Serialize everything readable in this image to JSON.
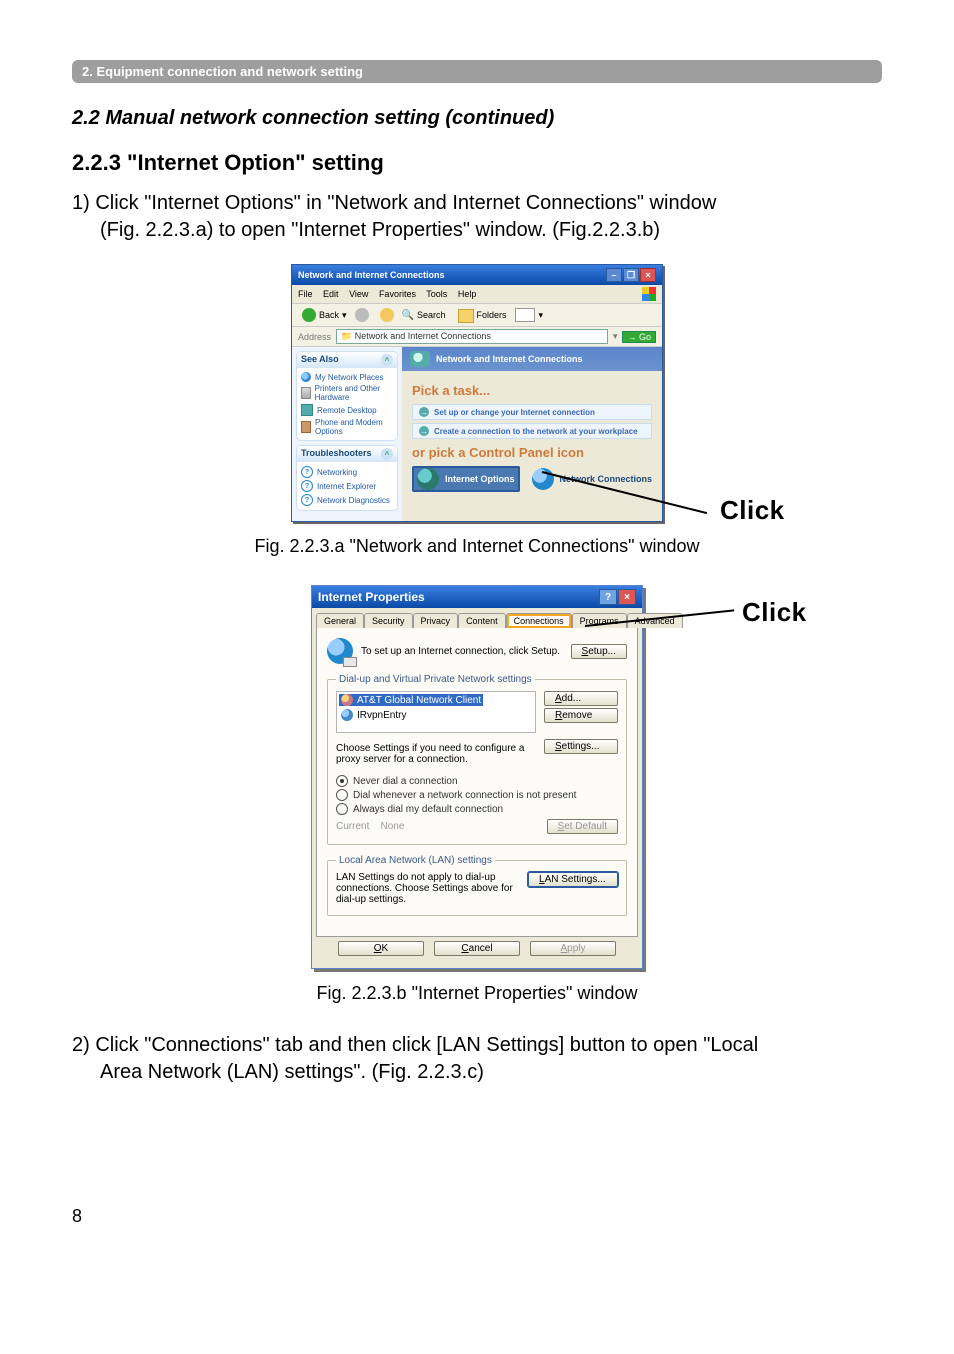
{
  "section_bar": "2. Equipment connection and network setting",
  "h2": "2.2 Manual network connection setting (continued)",
  "h3": "2.2.3 \"Internet Option\" setting",
  "para1_a": "1) Click \"Internet Options\" in \"Network and Internet Connections\" window",
  "para1_b": "(Fig. 2.2.3.a) to open \"Internet Properties\" window. (Fig.2.2.3.b)",
  "fig_a_caption": "Fig. 2.2.3.a \"Network and Internet Connections\" window",
  "fig_b_caption": "Fig. 2.2.3.b \"Internet Properties\" window",
  "para2_a": "2) Click \"Connections\" tab and then click [LAN Settings] button to open \"Local",
  "para2_b": "Area Network (LAN) settings\". (Fig. 2.2.3.c)",
  "page_number": "8",
  "click_label": "Click",
  "figA": {
    "title": "Network and Internet Connections",
    "menus": [
      "File",
      "Edit",
      "View",
      "Favorites",
      "Tools",
      "Help"
    ],
    "toolbar": {
      "back": "Back",
      "search": "Search",
      "folders": "Folders"
    },
    "address_label": "Address",
    "address_value": "Network and Internet Connections",
    "go": "Go",
    "side_seealso": "See Also",
    "side_links": [
      "My Network Places",
      "Printers and Other Hardware",
      "Remote Desktop",
      "Phone and Modem Options"
    ],
    "side_troubleshooters": "Troubleshooters",
    "side_ts_links": [
      "Networking",
      "Internet Explorer",
      "Network Diagnostics"
    ],
    "main_head": "Network and Internet Connections",
    "pick_task": "Pick a task...",
    "task1": "Set up or change your Internet connection",
    "task2": "Create a connection to the network at your workplace",
    "pick_cp": "or pick a Control Panel icon",
    "cp_internet": "Internet Options",
    "cp_netconn": "Network Connections"
  },
  "figB": {
    "title": "Internet Properties",
    "tabs": [
      "General",
      "Security",
      "Privacy",
      "Content",
      "Connections",
      "Programs",
      "Advanced"
    ],
    "active_tab": "Connections",
    "intro": "To set up an Internet connection, click Setup.",
    "setup_btn": "Setup...",
    "dial_legend": "Dial-up and Virtual Private Network settings",
    "list": [
      "AT&T Global Network Client",
      "IRvpnEntry"
    ],
    "add_btn": "Add...",
    "remove_btn": "Remove",
    "settings_btn": "Settings...",
    "choose_note": "Choose Settings if you need to configure a proxy server for a connection.",
    "radios": [
      "Never dial a connection",
      "Dial whenever a network connection is not present",
      "Always dial my default connection"
    ],
    "current_label": "Current",
    "current_value": "None",
    "setdefault": "Set Default",
    "lan_legend": "Local Area Network (LAN) settings",
    "lan_note": "LAN Settings do not apply to dial-up connections. Choose Settings above for dial-up settings.",
    "lan_btn": "LAN Settings...",
    "ok": "OK",
    "cancel": "Cancel",
    "apply": "Apply"
  }
}
